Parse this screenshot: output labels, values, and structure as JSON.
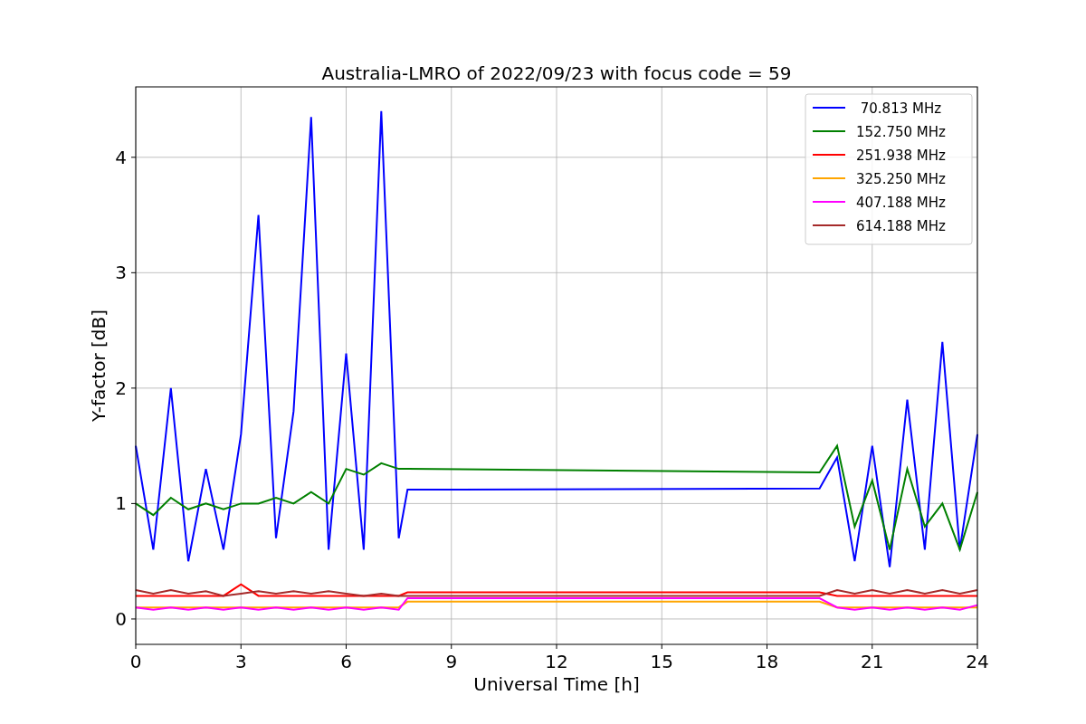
{
  "figure": {
    "chart_data": {
      "type": "line",
      "title": "Australia-LMRO of 2022/09/23 with focus code = 59",
      "xlabel": "Universal Time [h]",
      "ylabel": "Y-factor [dB]",
      "x": [
        0,
        0.5,
        1,
        1.5,
        2,
        2.5,
        3,
        3.5,
        4,
        4.5,
        5,
        5.5,
        6,
        6.5,
        7,
        7.5,
        7.75,
        19.5,
        20,
        20.5,
        21,
        21.5,
        22,
        22.5,
        23,
        23.5,
        24
      ],
      "series": [
        {
          "name": " 70.813 MHz",
          "color": "#0000ff",
          "values": [
            1.5,
            0.6,
            2.0,
            0.5,
            1.3,
            0.6,
            1.6,
            3.5,
            0.7,
            1.8,
            4.35,
            0.6,
            2.3,
            0.6,
            4.4,
            0.7,
            1.12,
            1.13,
            1.4,
            0.5,
            1.5,
            0.45,
            1.9,
            0.6,
            2.4,
            0.6,
            1.6
          ]
        },
        {
          "name": "152.750 MHz",
          "color": "#008000",
          "values": [
            1.0,
            0.9,
            1.05,
            0.95,
            1.0,
            0.95,
            1.0,
            1.0,
            1.05,
            1.0,
            1.1,
            1.0,
            1.3,
            1.25,
            1.35,
            1.3,
            1.3,
            1.27,
            1.5,
            0.8,
            1.2,
            0.6,
            1.3,
            0.8,
            1.0,
            0.6,
            1.1
          ]
        },
        {
          "name": "251.938 MHz",
          "color": "#ff0000",
          "values": [
            0.2,
            0.2,
            0.2,
            0.2,
            0.2,
            0.2,
            0.3,
            0.2,
            0.2,
            0.2,
            0.2,
            0.2,
            0.2,
            0.2,
            0.2,
            0.2,
            0.23,
            0.23,
            0.2,
            0.2,
            0.2,
            0.2,
            0.2,
            0.2,
            0.2,
            0.2,
            0.2
          ]
        },
        {
          "name": "325.250 MHz",
          "color": "#ffa500",
          "values": [
            0.1,
            0.1,
            0.1,
            0.1,
            0.1,
            0.1,
            0.1,
            0.1,
            0.1,
            0.1,
            0.1,
            0.1,
            0.1,
            0.1,
            0.1,
            0.1,
            0.15,
            0.15,
            0.1,
            0.1,
            0.1,
            0.1,
            0.1,
            0.1,
            0.1,
            0.1,
            0.1
          ]
        },
        {
          "name": "407.188 MHz",
          "color": "#ff00ff",
          "values": [
            0.1,
            0.08,
            0.1,
            0.08,
            0.1,
            0.08,
            0.1,
            0.08,
            0.1,
            0.08,
            0.1,
            0.08,
            0.1,
            0.08,
            0.1,
            0.08,
            0.18,
            0.18,
            0.1,
            0.08,
            0.1,
            0.08,
            0.1,
            0.08,
            0.1,
            0.08,
            0.12
          ]
        },
        {
          "name": "614.188 MHz",
          "color": "#a52a2a",
          "values": [
            0.25,
            0.22,
            0.25,
            0.22,
            0.24,
            0.2,
            0.22,
            0.24,
            0.22,
            0.24,
            0.22,
            0.24,
            0.22,
            0.2,
            0.22,
            0.2,
            0.2,
            0.2,
            0.25,
            0.22,
            0.25,
            0.22,
            0.25,
            0.22,
            0.25,
            0.22,
            0.25
          ]
        }
      ],
      "grid": true,
      "legend": true,
      "xlim": [
        0,
        24
      ],
      "ylim": [
        -0.22,
        4.61
      ],
      "xticks": [
        0,
        3,
        6,
        9,
        12,
        15,
        18,
        21,
        24
      ],
      "yticks": [
        0,
        1,
        2,
        3,
        4
      ]
    }
  }
}
